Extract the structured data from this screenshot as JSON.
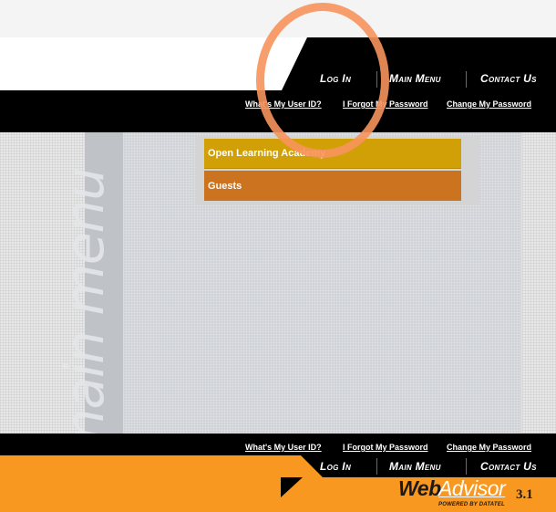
{
  "header": {
    "nav": [
      {
        "label": "Log In"
      },
      {
        "label": "Main Menu"
      },
      {
        "label": "Contact Us"
      }
    ],
    "util_links": [
      {
        "label": "What's My User ID?"
      },
      {
        "label": "I Forgot My Password"
      },
      {
        "label": "Change My Password"
      }
    ]
  },
  "main": {
    "vertical_title": "main menu",
    "menu_items": [
      {
        "label": "Open Learning Academy"
      },
      {
        "label": "Guests"
      }
    ]
  },
  "footer": {
    "util_links": [
      {
        "label": "What's My User ID?"
      },
      {
        "label": "I Forgot My Password"
      },
      {
        "label": "Change My Password"
      }
    ],
    "nav": [
      {
        "label": "Log In"
      },
      {
        "label": "Main Menu"
      },
      {
        "label": "Contact Us"
      }
    ],
    "logo": {
      "web": "Web",
      "advisor": "Advisor",
      "version": "3.1",
      "powered": "POWERED BY DATATEL"
    }
  },
  "colors": {
    "accent_orange": "#f89820",
    "menu_gold": "#d19f06",
    "menu_orange": "#cc7320",
    "highlight": "#f7945d"
  }
}
